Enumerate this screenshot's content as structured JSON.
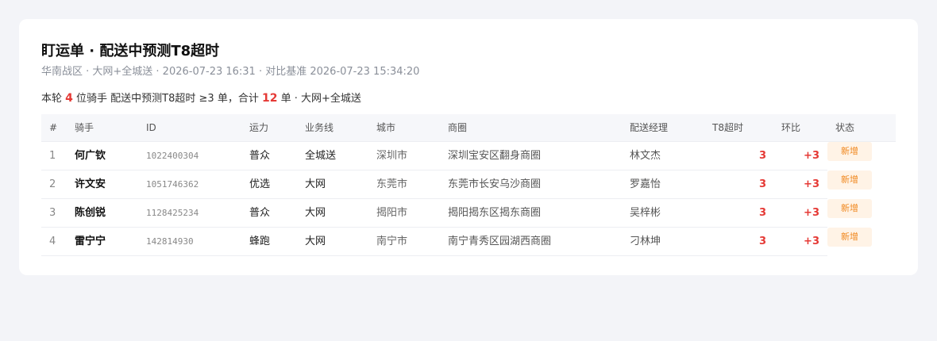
{
  "header": {
    "title": "盯运单 · 配送中预测T8超时",
    "subtitle": "华南战区 · 大网+全城送 · 2026-07-23 16:31 · 对比基准 2026-07-23 15:34:20"
  },
  "summary": {
    "prefix": "本轮",
    "rider_count": "4",
    "middle": "位骑手 配送中预测T8超时 ≥3 单，合计",
    "order_count": "12",
    "suffix": "单 · 大网+全城送"
  },
  "table": {
    "columns": [
      "#",
      "骑手",
      "ID",
      "运力",
      "业务线",
      "城市",
      "商圈",
      "配送经理",
      "T8超时",
      "环比",
      "状态"
    ],
    "rows": [
      {
        "idx": "1",
        "rider": "何广钦",
        "id": "1022400304",
        "capacity": "普众",
        "line": "全城送",
        "city": "深圳市",
        "area": "深圳宝安区翻身商圈",
        "manager": "林文杰",
        "t8": "3",
        "mom": "+3",
        "status": "新增"
      },
      {
        "idx": "2",
        "rider": "许文安",
        "id": "1051746362",
        "capacity": "优选",
        "line": "大网",
        "city": "东莞市",
        "area": "东莞市长安乌沙商圈",
        "manager": "罗嘉怡",
        "t8": "3",
        "mom": "+3",
        "status": "新增"
      },
      {
        "idx": "3",
        "rider": "陈创锐",
        "id": "1128425234",
        "capacity": "普众",
        "line": "大网",
        "city": "揭阳市",
        "area": "揭阳揭东区揭东商圈",
        "manager": "吴梓彬",
        "t8": "3",
        "mom": "+3",
        "status": "新增"
      },
      {
        "idx": "4",
        "rider": "雷宁宁",
        "id": "142814930",
        "capacity": "蜂跑",
        "line": "大网",
        "city": "南宁市",
        "area": "南宁青秀区园湖西商圈",
        "manager": "刁林坤",
        "t8": "3",
        "mom": "+3",
        "status": "新增"
      }
    ]
  }
}
